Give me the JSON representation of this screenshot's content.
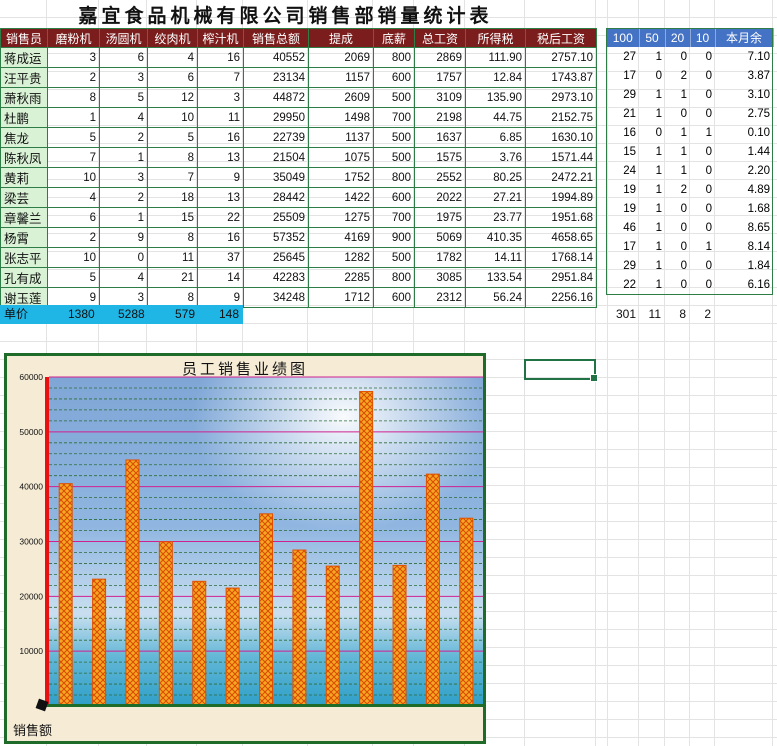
{
  "sheet": {
    "title": "嘉宜食品机械有限公司销售部销量统计表",
    "headers": [
      "销售员",
      "磨粉机",
      "汤圆机",
      "绞肉机",
      "榨汁机",
      "销售总额",
      "提成",
      "底薪",
      "总工资",
      "所得税",
      "税后工资"
    ],
    "rows": [
      {
        "name": "蒋成运",
        "v": [
          "3",
          "6",
          "4",
          "16",
          "40552",
          "2069",
          "800",
          "2869",
          "111.90",
          "2757.10"
        ]
      },
      {
        "name": "汪平贵",
        "v": [
          "2",
          "3",
          "6",
          "7",
          "23134",
          "1157",
          "600",
          "1757",
          "12.84",
          "1743.87"
        ]
      },
      {
        "name": "萧秋雨",
        "v": [
          "8",
          "5",
          "12",
          "3",
          "44872",
          "2609",
          "500",
          "3109",
          "135.90",
          "2973.10"
        ]
      },
      {
        "name": "杜鹏",
        "v": [
          "1",
          "4",
          "10",
          "11",
          "29950",
          "1498",
          "700",
          "2198",
          "44.75",
          "2152.75"
        ]
      },
      {
        "name": "焦龙",
        "v": [
          "5",
          "2",
          "5",
          "16",
          "22739",
          "1137",
          "500",
          "1637",
          "6.85",
          "1630.10"
        ]
      },
      {
        "name": "陈秋凤",
        "v": [
          "7",
          "1",
          "8",
          "13",
          "21504",
          "1075",
          "500",
          "1575",
          "3.76",
          "1571.44"
        ]
      },
      {
        "name": "黄莉",
        "v": [
          "10",
          "3",
          "7",
          "9",
          "35049",
          "1752",
          "800",
          "2552",
          "80.25",
          "2472.21"
        ]
      },
      {
        "name": "梁芸",
        "v": [
          "4",
          "2",
          "18",
          "13",
          "28442",
          "1422",
          "600",
          "2022",
          "27.21",
          "1994.89"
        ]
      },
      {
        "name": "章馨兰",
        "v": [
          "6",
          "1",
          "15",
          "22",
          "25509",
          "1275",
          "700",
          "1975",
          "23.77",
          "1951.68"
        ]
      },
      {
        "name": "杨霄",
        "v": [
          "2",
          "9",
          "8",
          "16",
          "57352",
          "4169",
          "900",
          "5069",
          "410.35",
          "4658.65"
        ]
      },
      {
        "name": "张志平",
        "v": [
          "10",
          "0",
          "11",
          "37",
          "25645",
          "1282",
          "500",
          "1782",
          "14.11",
          "1768.14"
        ]
      },
      {
        "name": "孔有成",
        "v": [
          "5",
          "4",
          "21",
          "14",
          "42283",
          "2285",
          "800",
          "3085",
          "133.54",
          "2951.84"
        ]
      },
      {
        "name": "谢玉莲",
        "v": [
          "9",
          "3",
          "8",
          "9",
          "34248",
          "1712",
          "600",
          "2312",
          "56.24",
          "2256.16"
        ]
      }
    ],
    "unit_row": {
      "label": "单价",
      "values": [
        "1380",
        "5288",
        "579",
        "148"
      ]
    }
  },
  "side": {
    "headers": [
      "100",
      "50",
      "20",
      "10",
      "本月余"
    ],
    "rows": [
      [
        "27",
        "1",
        "0",
        "0",
        "7.10"
      ],
      [
        "17",
        "0",
        "2",
        "0",
        "3.87"
      ],
      [
        "29",
        "1",
        "1",
        "0",
        "3.10"
      ],
      [
        "21",
        "1",
        "0",
        "0",
        "2.75"
      ],
      [
        "16",
        "0",
        "1",
        "1",
        "0.10"
      ],
      [
        "15",
        "1",
        "1",
        "0",
        "1.44"
      ],
      [
        "24",
        "1",
        "1",
        "0",
        "2.20"
      ],
      [
        "19",
        "1",
        "2",
        "0",
        "4.89"
      ],
      [
        "19",
        "1",
        "0",
        "0",
        "1.68"
      ],
      [
        "46",
        "1",
        "0",
        "0",
        "8.65"
      ],
      [
        "17",
        "1",
        "0",
        "1",
        "8.14"
      ],
      [
        "29",
        "1",
        "0",
        "0",
        "1.84"
      ],
      [
        "22",
        "1",
        "0",
        "0",
        "6.16"
      ]
    ],
    "totals": [
      "301",
      "11",
      "8",
      "2"
    ]
  },
  "colors": {
    "header_bg": "#7b1d1d",
    "name_bg": "#d9f2d5",
    "border": "#2e7d46",
    "side_header": "#4472c4",
    "unit_bg": "#1fb6e6",
    "bar": "#f0a020",
    "bar_edge": "#d94a00"
  },
  "chart_data": {
    "type": "bar",
    "title": "员工销售业绩图",
    "xlabel": "销售额",
    "ylabel": "",
    "ylim": [
      0,
      60000
    ],
    "yticks": [
      "0",
      "10000",
      "20000",
      "30000",
      "40000",
      "50000",
      "60000"
    ],
    "values": [
      40552,
      23134,
      44872,
      29950,
      22739,
      21504,
      35049,
      28442,
      25509,
      57352,
      25645,
      42283,
      34248
    ],
    "grid": true,
    "legend": "none"
  }
}
